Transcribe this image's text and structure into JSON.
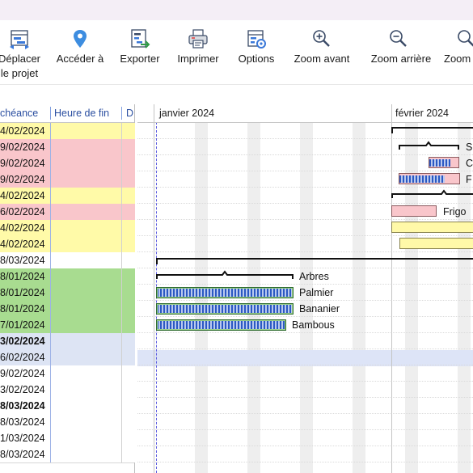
{
  "toolbar": {
    "buttons": [
      {
        "id": "deplacer",
        "label_line1": "Déplacer",
        "label_line2": "le projet",
        "icon": "move-project-icon"
      },
      {
        "id": "acceder",
        "label_line1": "Accéder à",
        "icon": "location-pin-icon"
      },
      {
        "id": "exporter",
        "label_line1": "Exporter",
        "icon": "export-icon"
      },
      {
        "id": "imprimer",
        "label_line1": "Imprimer",
        "icon": "printer-icon"
      },
      {
        "id": "options",
        "label_line1": "Options",
        "icon": "options-icon"
      },
      {
        "id": "zoom_avant",
        "label_line1": "Zoom avant",
        "icon": "zoom-in-icon"
      },
      {
        "id": "zoom_arriere",
        "label_line1": "Zoom arrière",
        "icon": "zoom-out-icon"
      },
      {
        "id": "zoom_more",
        "label_line1": "Zoom",
        "icon": "zoom-icon"
      }
    ]
  },
  "grid": {
    "headers": {
      "due": "chéance",
      "end_time": "Heure de fin",
      "col3": "D"
    },
    "rows": [
      {
        "due": "4/02/2024",
        "color": "#fffaa8",
        "bold": false
      },
      {
        "due": "9/02/2024",
        "color": "#f9c6cb",
        "bold": false
      },
      {
        "due": "9/02/2024",
        "color": "#f9c6cb",
        "bold": false
      },
      {
        "due": "9/02/2024",
        "color": "#f9c6cb",
        "bold": false
      },
      {
        "due": "4/02/2024",
        "color": "#fffaa8",
        "bold": false
      },
      {
        "due": "6/02/2024",
        "color": "#f9c6cb",
        "bold": false
      },
      {
        "due": "4/02/2024",
        "color": "#fffaa8",
        "bold": false
      },
      {
        "due": "4/02/2024",
        "color": "#fffaa8",
        "bold": false
      },
      {
        "due": "8/03/2024",
        "color": "#ffffff",
        "bold": false
      },
      {
        "due": "8/01/2024",
        "color": "#a8dc90",
        "bold": false
      },
      {
        "due": "8/01/2024",
        "color": "#a8dc90",
        "bold": false
      },
      {
        "due": "8/01/2024",
        "color": "#a8dc90",
        "bold": false
      },
      {
        "due": "7/01/2024",
        "color": "#a8dc90",
        "bold": false
      },
      {
        "due": "3/02/2024",
        "color": "#dde4f4",
        "bold": true
      },
      {
        "due": "6/02/2024",
        "color": "#dde4f4",
        "bold": false
      },
      {
        "due": "9/02/2024",
        "color": "#ffffff",
        "bold": false
      },
      {
        "due": "3/02/2024",
        "color": "#ffffff",
        "bold": false
      },
      {
        "due": "8/03/2024",
        "color": "#ffffff",
        "bold": true
      },
      {
        "due": "8/03/2024",
        "color": "#ffffff",
        "bold": false
      },
      {
        "due": "1/03/2024",
        "color": "#ffffff",
        "bold": false
      },
      {
        "due": "8/03/2024",
        "color": "#ffffff",
        "bold": false
      }
    ]
  },
  "gantt": {
    "months": [
      {
        "label": "janvier 2024"
      },
      {
        "label": "février 2024"
      }
    ],
    "task_labels": {
      "s": "S",
      "c": "C",
      "f": "F",
      "frigo": "Frigo",
      "arbres": "Arbres",
      "palmier": "Palmier",
      "bananier": "Bananier",
      "bambous": "Bambous"
    }
  }
}
